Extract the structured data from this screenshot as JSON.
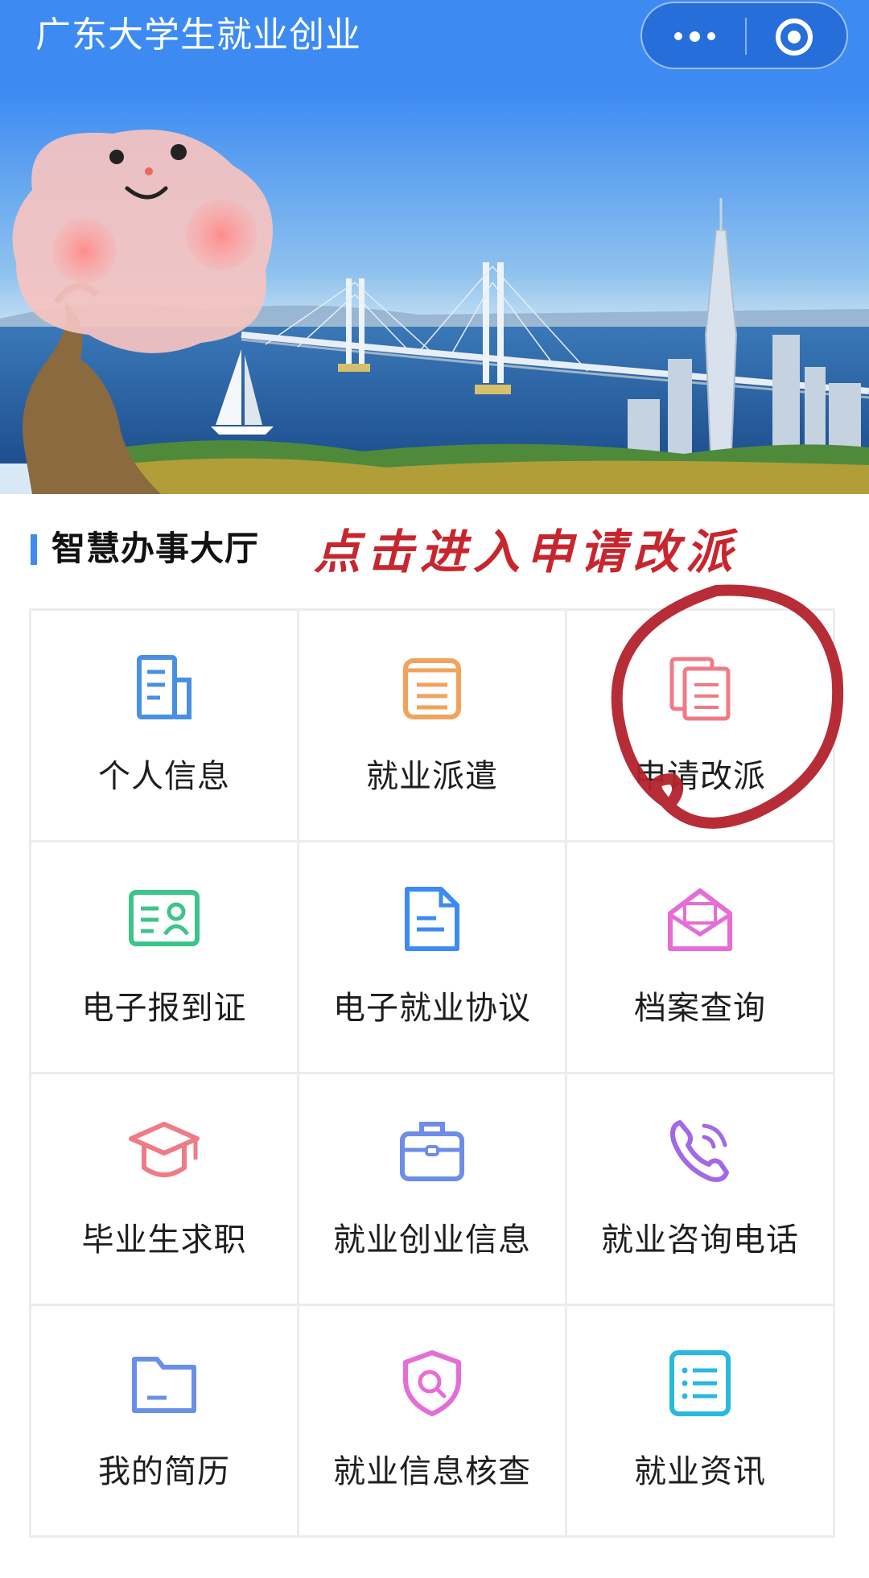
{
  "header": {
    "title": "广东大学生就业创业",
    "menu_icon": "more-dots-icon",
    "close_icon": "close-circle-icon",
    "bar_color": "#3d8bf2"
  },
  "banner": {
    "description_icons": [
      "cartoon-face-sticker",
      "five-rams-statue",
      "sailboat",
      "cable-bridge",
      "canton-tower"
    ]
  },
  "section": {
    "title": "智慧办事大厅",
    "annotation": "点击进入申请改派",
    "annotation_color": "#c8262e",
    "accent_color": "#3d8bf2"
  },
  "tiles": [
    {
      "label": "个人信息",
      "icon": "document-icon",
      "color": "#4a90e2"
    },
    {
      "label": "就业派遣",
      "icon": "notepad-icon",
      "color": "#f3a25b"
    },
    {
      "label": "申请改派",
      "icon": "copy-docs-icon",
      "color": "#ef7b86"
    },
    {
      "label": "电子报到证",
      "icon": "id-card-icon",
      "color": "#3cc48a"
    },
    {
      "label": "电子就业协议",
      "icon": "agreement-doc-icon",
      "color": "#3d8bf2"
    },
    {
      "label": "档案查询",
      "icon": "envelope-icon",
      "color": "#e66dd5"
    },
    {
      "label": "毕业生求职",
      "icon": "graduation-cap-icon",
      "color": "#ef7b86"
    },
    {
      "label": "就业创业信息",
      "icon": "briefcase-icon",
      "color": "#6c8ee8"
    },
    {
      "label": "就业咨询电话",
      "icon": "phone-icon",
      "color": "#a169e6"
    },
    {
      "label": "我的简历",
      "icon": "folder-icon",
      "color": "#6a8fe8"
    },
    {
      "label": "就业信息核查",
      "icon": "shield-search-icon",
      "color": "#e66dd5"
    },
    {
      "label": "就业资讯",
      "icon": "list-icon",
      "color": "#27b9e0"
    }
  ]
}
